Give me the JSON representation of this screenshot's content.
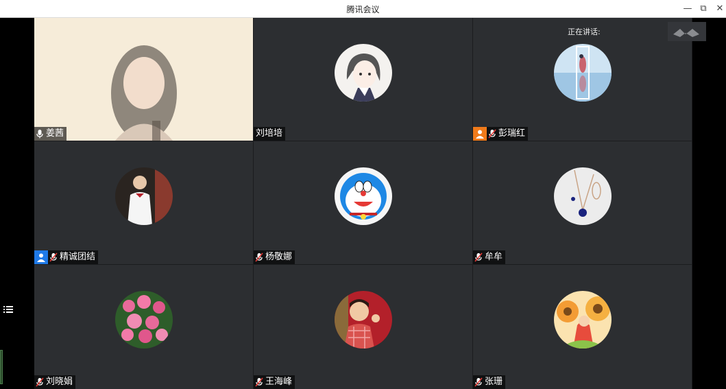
{
  "window": {
    "title": "腾讯会议"
  },
  "controls": {
    "minimize": "—",
    "restore": "⧉",
    "close": "✕"
  },
  "speaking_label": "正在讲话:",
  "participants": [
    {
      "name": "姜茜",
      "type": "video",
      "mic_state": "on",
      "role": ""
    },
    {
      "name": "刘培培",
      "type": "avatar",
      "mic_state": "none",
      "role": "",
      "avatar": "anime-girl"
    },
    {
      "name": "彭瑞红",
      "type": "avatar",
      "mic_state": "muted",
      "role": "host",
      "avatar": "wedding-photo"
    },
    {
      "name": "精诚团结",
      "type": "avatar",
      "mic_state": "muted",
      "role": "cohost",
      "avatar": "man-suit"
    },
    {
      "name": "杨敬娜",
      "type": "avatar",
      "mic_state": "muted",
      "role": "",
      "avatar": "doraemon"
    },
    {
      "name": "牟牟",
      "type": "avatar",
      "mic_state": "muted",
      "role": "",
      "avatar": "necklace"
    },
    {
      "name": "刘晓娟",
      "type": "avatar",
      "mic_state": "muted",
      "role": "",
      "avatar": "roses"
    },
    {
      "name": "王海峰",
      "type": "avatar",
      "mic_state": "muted",
      "role": "",
      "avatar": "girl-red"
    },
    {
      "name": "张珊",
      "type": "avatar",
      "mic_state": "muted",
      "role": "",
      "avatar": "illustration"
    }
  ],
  "colors": {
    "host_badge": "#f07a1a",
    "cohost_badge": "#1f7ae8",
    "tile_bg": "#2c2e31",
    "grid_bg": "#1b1c1e"
  }
}
